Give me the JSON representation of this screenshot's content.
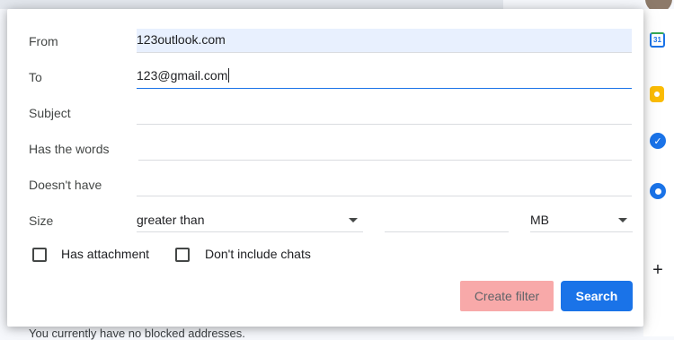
{
  "form": {
    "from": {
      "label": "From",
      "value": "123outlook.com"
    },
    "to": {
      "label": "To",
      "value": "123@gmail.com"
    },
    "subject": {
      "label": "Subject",
      "value": ""
    },
    "has_words": {
      "label": "Has the words",
      "value": ""
    },
    "doesnt_have": {
      "label": "Doesn't have",
      "value": ""
    },
    "size": {
      "label": "Size",
      "operator": "greater than",
      "amount": "",
      "unit": "MB"
    },
    "has_attachment": {
      "label": "Has attachment",
      "checked": false
    },
    "dont_include_chats": {
      "label": "Don't include chats",
      "checked": false
    }
  },
  "buttons": {
    "create_filter": "Create filter",
    "search": "Search"
  },
  "background": {
    "footer_text": "You currently have no blocked addresses.",
    "calendar_day": "31",
    "plus": "+"
  },
  "colors": {
    "accent": "#1a73e8",
    "create_filter_highlight": "#f8a9a9",
    "filled_field": "#e8f0fe"
  },
  "icons": [
    "calendar-icon",
    "keep-icon",
    "tasks-icon",
    "contacts-icon",
    "plus-icon",
    "dropdown-arrow-icon"
  ]
}
